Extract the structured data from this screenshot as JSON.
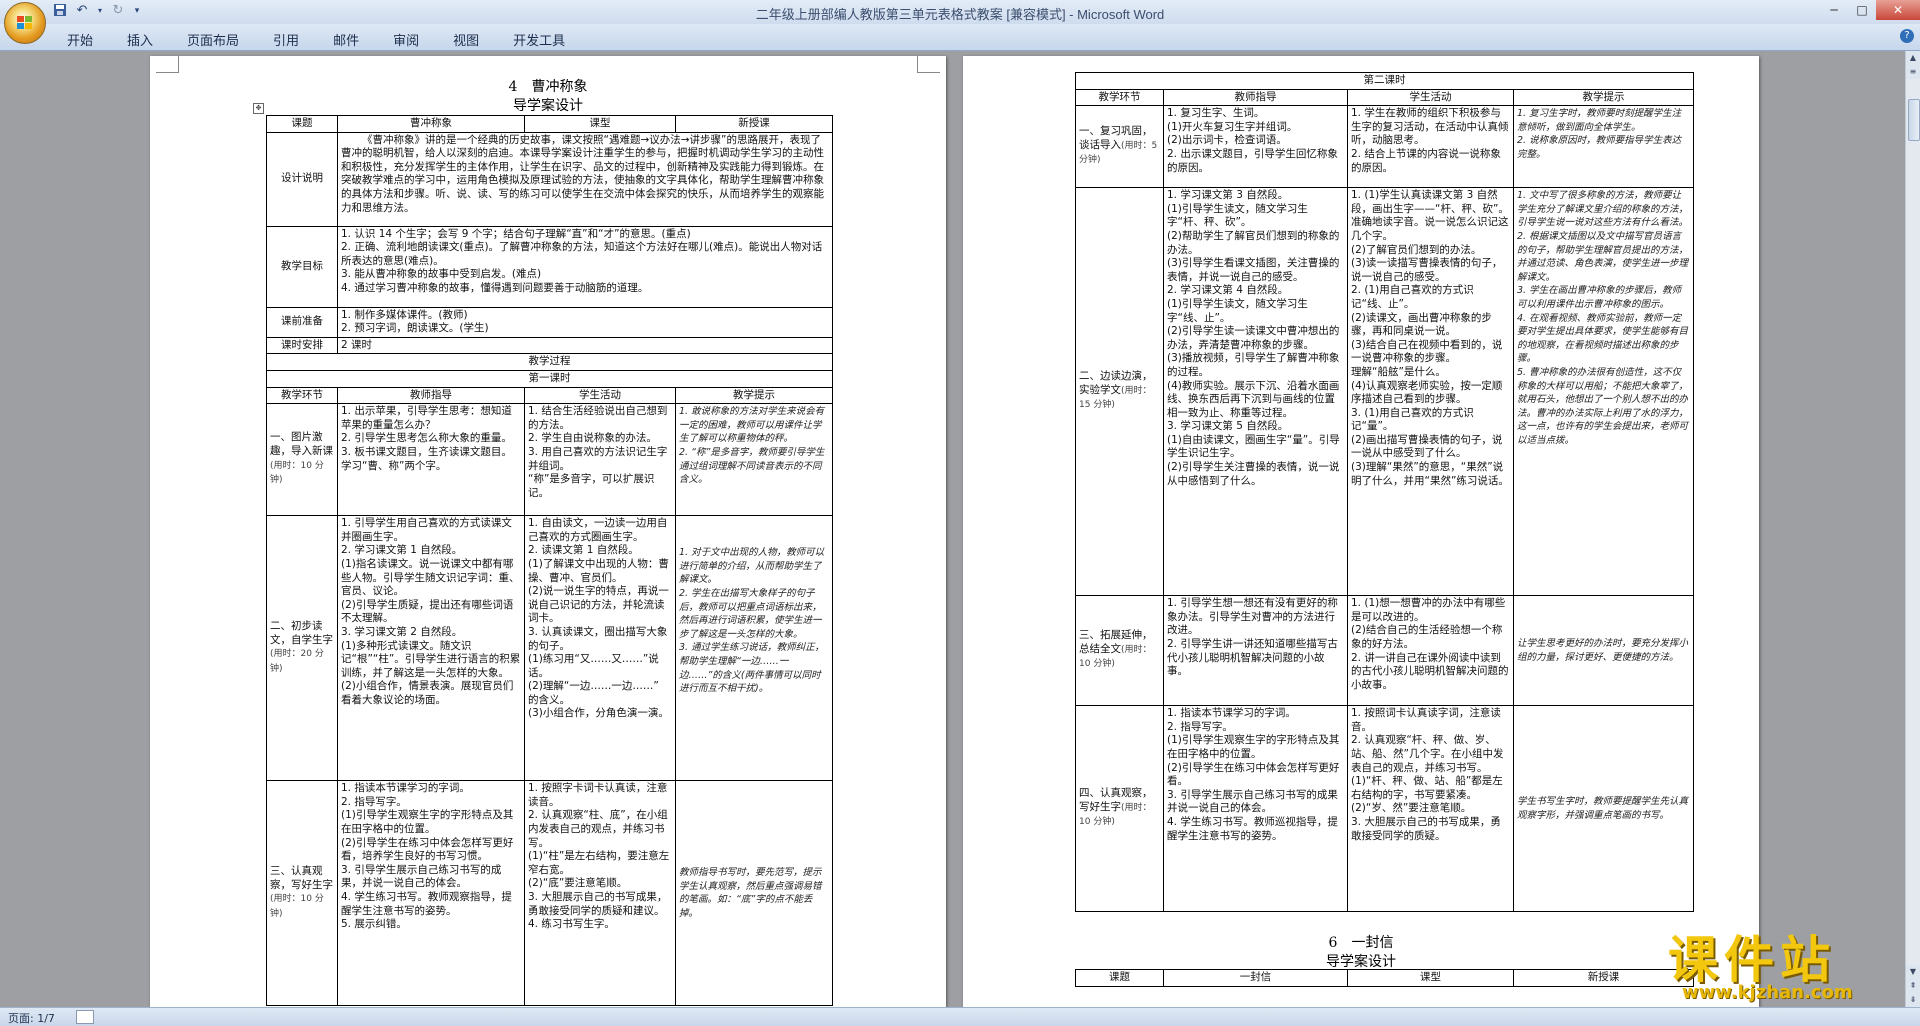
{
  "window": {
    "title": "二年级上册部编人教版第三单元表格式教案 [兼容模式] - Microsoft Word"
  },
  "ribbon": {
    "tabs": [
      "开始",
      "插入",
      "页面布局",
      "引用",
      "邮件",
      "审阅",
      "视图",
      "开发工具"
    ]
  },
  "status": {
    "page_label": "页面: 1/7"
  },
  "page1": {
    "heading1": "4　曹冲称象",
    "heading2": "导学案设计",
    "row_topic": {
      "k": "课题",
      "v": "曹冲称象",
      "k2": "课型",
      "v2": "新授课"
    },
    "design_label": "设计说明",
    "design_text": "《曹冲称象》讲的是一个经典的历史故事，课文按照“遇难题→议办法→讲步骤”的思路展开，表现了曹冲的聪明机智，给人以深刻的启迪。本课导学案设计注重学生的参与，把握时机调动学生学习的主动性和积极性，充分发挥学生的主体作用，让学生在识字、品文的过程中，创新精神及实践能力得到锻炼。在突破教学难点的学习中，运用角色模拟及原理试验的方法，使抽象的文字具体化，帮助学生理解曹冲称象的具体方法和步骤。听、说、读、写的练习可以使学生在交流中体会探究的快乐，从而培养学生的观察能力和思维方法。",
    "goal_label": "教学目标",
    "goals": [
      "1. 认识 14 个生字；会写 9 个字；结合句子理解“直”和“才”的意思。(重点)",
      "2. 正确、流利地朗读课文(重点)。了解曹冲称象的方法，知道这个方法好在哪儿(难点)。能说出人物对话所表达的意思(难点)。",
      "3. 能从曹冲称象的故事中受到启发。(难点)",
      "4. 通过学习曹冲称象的故事，懂得遇到问题要善于动脑筋的道理。"
    ],
    "prep_label": "课前准备",
    "preps": [
      "1. 制作多媒体课件。(教师)",
      "2. 预习字词，朗读课文。(学生)"
    ],
    "time_label": "课时安排",
    "time_value": "2 课时",
    "process_label": "教学过程",
    "lesson1_label": "第一课时",
    "cols": [
      "教学环节",
      "教师指导",
      "学生活动",
      "教学提示"
    ],
    "rows": [
      {
        "stage": "一、图片激趣，导入新课",
        "time": "(用时：10 分钟)",
        "teacher": "1. 出示苹果，引导学生思考：想知道苹果的重量怎么办？\n2. 引导学生思考怎么称大象的重量。\n3. 板书课文题目，生齐读课文题目。学习“曹、称”两个字。",
        "student": "1. 结合生活经验说出自己想到的方法。\n2. 学生自由说称象的办法。\n3. 用自己喜欢的方法识记生字并组词。\n“称”是多音字，可以扩展识记。",
        "tip": "1. 敢说称象的方法对学生来说会有一定的困难，教师可以用课件让学生了解可以称重物体的秤。\n2. “称”是多音字，教师要引导学生通过组词理解不同读音表示的不同含义。"
      },
      {
        "stage": "二、初步读文，自学生字",
        "time": "(用时：20 分钟)",
        "teacher": "1. 引导学生用自己喜欢的方式读课文并圈画生字。\n2. 学习课文第 1 自然段。\n(1)指名读课文。说一说课文中都有哪些人物。引导学生随文识记字词：重、官员、议论。\n(2)引导学生质疑，提出还有哪些词语不太理解。\n3. 学习课文第 2 自然段。\n(1)多种形式读课文。随文识记“根”“柱”。引导学生进行语言的积累训练，并了解这是一头怎样的大象。\n(2)小组合作，情景表演。展现官员们看着大象议论的场面。",
        "student": "1. 自由读文，一边读一边用自己喜欢的方式圈画生字。\n2. 读课文第 1 自然段。\n(1)了解课文中出现的人物：曹操、曹冲、官员们。\n(2)说一说生字的特点，再说一说自己识记的方法，并轮流读词卡。\n3. 认真读课文，圈出描写大象的句子。\n(1)练习用“又……又……”说话。\n(2)理解“一边……一边……”\n的含义。\n(3)小组合作，分角色演一演。",
        "tip": "1. 对于文中出现的人物，教师可以进行简单的介绍，从而帮助学生了解课文。\n2. 学生在出描写大象样子的句子后，教师可以把重点词语标出来，然后再进行词语积累，使学生进一步了解这是一头怎样的大象。\n3. 通过学生练习说话，教师纠正，帮助学生理解“一边……一边……”的含义(两件事情可以同时进行而互不相干扰)。"
      },
      {
        "stage": "三、认真观察，写好生字",
        "time": "(用时：10 分钟)",
        "teacher": "1. 指读本节课学习的字词。\n2. 指导写字。\n(1)引导学生观察生字的字形特点及其在田字格中的位置。\n(2)引导学生在练习中体会怎样写更好看，培养学生良好的书写习惯。\n3. 引导学生展示自己练习书写的成果，并说一说自己的体会。\n4. 学生练习书写。教师观察指导，提醒学生注意书写的姿势。\n5. 展示纠错。",
        "student": "1. 按照字卡词卡认真读，注意读音。\n2. 认真观察“柱、底”，在小组内发表自己的观点，并练习书写。\n(1)“柱”是左右结构，要注意左窄右宽。\n(2)“底”要注意笔顺。\n3. 大胆展示自己的书写成果，勇敢接受同学的质疑和建议。\n4. 练习书写生字。",
        "tip": "教师指导书写时，要先范写，提示学生认真观察，然后重点强调易错的笔画。如：“底”字的点不能丢掉。"
      }
    ]
  },
  "page2": {
    "lesson2_label": "第二课时",
    "cols": [
      "教学环节",
      "教师指导",
      "学生活动",
      "教学提示"
    ],
    "rows": [
      {
        "stage": "一、复习巩固，谈话导入",
        "time": "(用时：5 分钟)",
        "teacher": "1. 复习生字、生词。\n(1)开火车复习生字并组词。\n(2)出示词卡，检查词语。\n2. 出示课文题目，引导学生回忆称象的原因。",
        "student": "1. 学生在教师的组织下积极参与生字的复习活动，在活动中认真倾听，动脑思考。\n2. 结合上节课的内容说一说称象的原因。",
        "tip": "1. 复习生字时，教师要时刻提醒学生注意倾听，做到面向全体学生。\n2. 说称象原因时，教师要指导学生表达完整。"
      },
      {
        "stage": "二、边读边演，实验学文",
        "time": "(用时：15 分钟)",
        "teacher": "1. 学习课文第 3 自然段。\n(1)引导学生读文，随文学习生字“杆、秤、砍”。\n(2)帮助学生了解官员们想到的称象的办法。\n(3)引导学生看课文插图，关注曹操的表情，并说一说自己的感受。\n2. 学习课文第 4 自然段。\n(1)引导学生读文，随文学习生字“线、止”。\n(2)引导学生读一读课文中曹冲想出的办法，弄清楚曹冲称象的步骤。\n(3)播放视频，引导学生了解曹冲称象的过程。\n(4)教师实验。展示下沉、沿着水面画线、换东西后再下沉到与画线的位置相一致为止、称重等过程。\n3. 学习课文第 5 自然段。\n(1)自由读课文，圈画生字“量”。引导学生识记生字。\n(2)引导学生关注曹操的表情，说一说从中感悟到了什么。",
        "student": "1. (1)学生认真读课文第 3 自然段，画出生字——“杆、秤、砍”。准确地读字音。说一说怎么识记这几个字。\n(2)了解官员们想到的办法。\n(3)读一读描写曹操表情的句子，说一说自己的感受。\n2. (1)用自己喜欢的方式识记“线、止”。\n(2)读课文，画出曹冲称象的步骤，再和同桌说一说。\n(3)结合自己在视频中看到的，说一说曹冲称象的步骤。\n理解“船舷”是什么。\n(4)认真观察老师实验，按一定顺序描述自己看到的步骤。\n3. (1)用自己喜欢的方式识记“量”。\n(2)画出描写曹操表情的句子，说一说从中感受到了什么。\n(3)理解“果然”的意思，“果然”说明了什么，并用“果然”练习说话。",
        "tip": "1. 文中写了很多称象的方法，教师要让学生充分了解课文里介绍的称象的方法，引导学生说一说对这些方法有什么看法。\n2. 根据课文插图以及文中描写官员语言的句子，帮助学生理解官员提出的方法，并通过范读、角色表演，使学生进一步理解课文。\n3. 学生在画出曹冲称象的步骤后，教师可以利用课件出示曹冲称象的图示。\n4. 在观看视频、教师实验前，教师一定要对学生提出具体要求，使学生能够有目的地观察，在看视频时描述出称象的步骤。\n5. 曹冲称象的办法很有创造性，这不仅称象的大样可以用船；不能把大象宰了，就用石头，他想出了一个别人想不出的办法。曹冲的办法实际上利用了水的浮力，这一点，也许有的学生会提出来，老师可以适当点拨。"
      },
      {
        "stage": "三、拓展延伸，总结全文",
        "time": "(用时：10 分钟)",
        "teacher": "1. 引导学生想一想还有没有更好的称象办法。引导学生对曹冲的方法进行改进。\n2. 引导学生讲一讲还知道哪些描写古代小孩儿聪明机智解决问题的小故事。",
        "student": "1. (1)想一想曹冲的办法中有哪些是可以改进的。\n(2)结合自己的生活经验想一个称象的好方法。\n2. 讲一讲自己在课外阅读中读到的古代小孩儿聪明机智解决问题的小故事。",
        "tip": "让学生思考更好的办法时，要充分发挥小组的力量，探讨更好、更便捷的方法。"
      },
      {
        "stage": "四、认真观察，写好生字",
        "time": "(用时：10 分钟)",
        "teacher": "1. 指读本节课学习的字词。\n2. 指导写字。\n(1)引导学生观察生字的字形特点及其在田字格中的位置。\n(2)引导学生在练习中体会怎样写更好看。\n3. 引导学生展示自己练习书写的成果并说一说自己的体会。\n4. 学生练习书写。教师巡视指导，提醒学生注意书写的姿势。",
        "student": "1. 按照词卡认真读字词，注意读音。\n2. 认真观察“杆、秤、做、岁、站、船、然”几个字。在小组中发表自己的观点，并练习书写。\n(1)“杆、秤、做、站、船”都是左右结构的字，书写要紧凑。\n(2)“岁、然”要注意笔顺。\n3. 大胆展示自己的书写成果，勇敢接受同学的质疑。",
        "tip": "学生书写生字时，教师要提醒学生先认真观察字形，并强调重点笔画的书写。"
      }
    ],
    "next_heading1": "6　一封信",
    "next_heading2": "导学案设计",
    "next_row": {
      "k": "课题",
      "v": "一封信",
      "k2": "课型",
      "v2": "新授课"
    }
  },
  "watermark": {
    "brand": "课件站",
    "url": "www.kjzhan.com"
  }
}
